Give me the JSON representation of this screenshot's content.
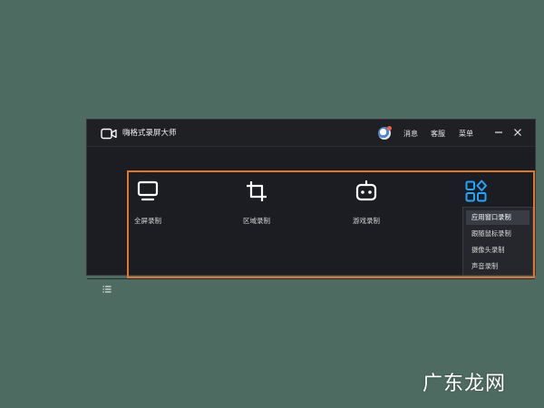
{
  "app": {
    "title": "嗨格式录屏大师",
    "logo_icon": "camera-icon"
  },
  "header": {
    "messages": "消息",
    "service": "客服",
    "menu": "菜单",
    "minimize_icon": "minimize-icon",
    "close_icon": "close-icon"
  },
  "modes": [
    {
      "id": "fullscreen",
      "label": "全屏录制",
      "icon": "monitor-icon"
    },
    {
      "id": "region",
      "label": "区域录制",
      "icon": "crop-icon"
    },
    {
      "id": "game",
      "label": "游戏录制",
      "icon": "gamepad-robot-icon"
    },
    {
      "id": "app",
      "label": "",
      "icon": "apps-grid-icon"
    }
  ],
  "dropdown": {
    "items": [
      "应用窗口录制",
      "跟随鼠标录制",
      "摄像头录制",
      "声音录制"
    ],
    "active_index": 0
  },
  "footer": {
    "menu_icon": "list-icon"
  },
  "watermark": "广东龙网",
  "colors": {
    "accent": "#1ea7ff",
    "highlight": "#e2762f",
    "background": "#4d6b60"
  }
}
